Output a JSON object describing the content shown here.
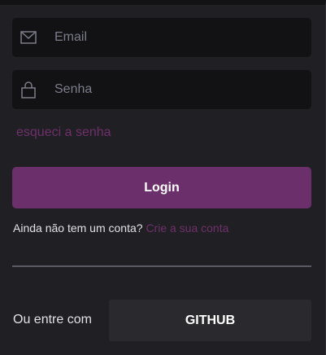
{
  "form": {
    "email": {
      "icon": "mail-icon",
      "placeholder": "Email",
      "value": ""
    },
    "password": {
      "icon": "lock-icon",
      "placeholder": "Senha",
      "value": ""
    },
    "forgot_link": "esqueci a senha",
    "login_label": "Login"
  },
  "signup": {
    "prompt": "Ainda não tem um conta?",
    "link": "Crie a sua conta"
  },
  "alternative": {
    "label": "Ou entre com",
    "github_label": "GITHUB"
  },
  "colors": {
    "background": "#202024",
    "input_background": "#121214",
    "accent": "#6b2f6b",
    "link": "#6f2f6a",
    "secondary_button": "#29292e"
  }
}
